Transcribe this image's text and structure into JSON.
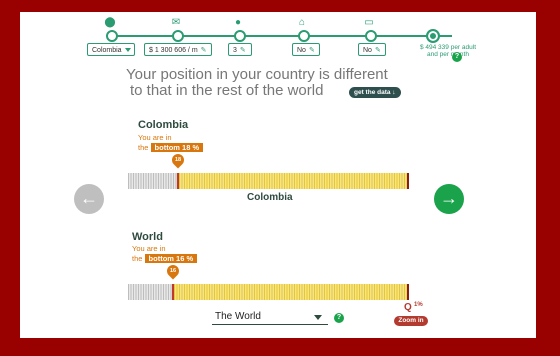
{
  "stepper": {
    "steps": [
      {
        "icon": "location-icon",
        "value": "Colombia",
        "has_dropdown": true
      },
      {
        "icon": "envelope-icon",
        "value": "$ 1 300 606 / m",
        "has_edit": true
      },
      {
        "icon": "person-icon",
        "value": "3",
        "has_edit": true
      },
      {
        "icon": "house-icon",
        "value": "No",
        "has_edit": true
      },
      {
        "icon": "card-icon",
        "value": "No",
        "has_edit": true
      }
    ],
    "result": "$ 494 339 per adult and per month"
  },
  "headline": {
    "line1": "Your position in your country is different",
    "line2": "to that in the rest of the world",
    "get_data": "get the data ↓"
  },
  "country": {
    "name": "Colombia",
    "you_are_in": "You are in",
    "the": "the",
    "badge": "bottom 18 %",
    "pin_value": "18",
    "percentile": 18,
    "bar_label": "Colombia"
  },
  "world": {
    "name": "World",
    "you_are_in": "You are in",
    "the": "the",
    "badge": "bottom 16 %",
    "pin_value": "16",
    "percentile": 16
  },
  "world_select": {
    "value": "The World"
  },
  "zoom": {
    "pct": "1%",
    "label": "Zoom in"
  },
  "colors": {
    "brand_green": "#2b9b72",
    "orange": "#d9770f",
    "frame": "#990000"
  }
}
